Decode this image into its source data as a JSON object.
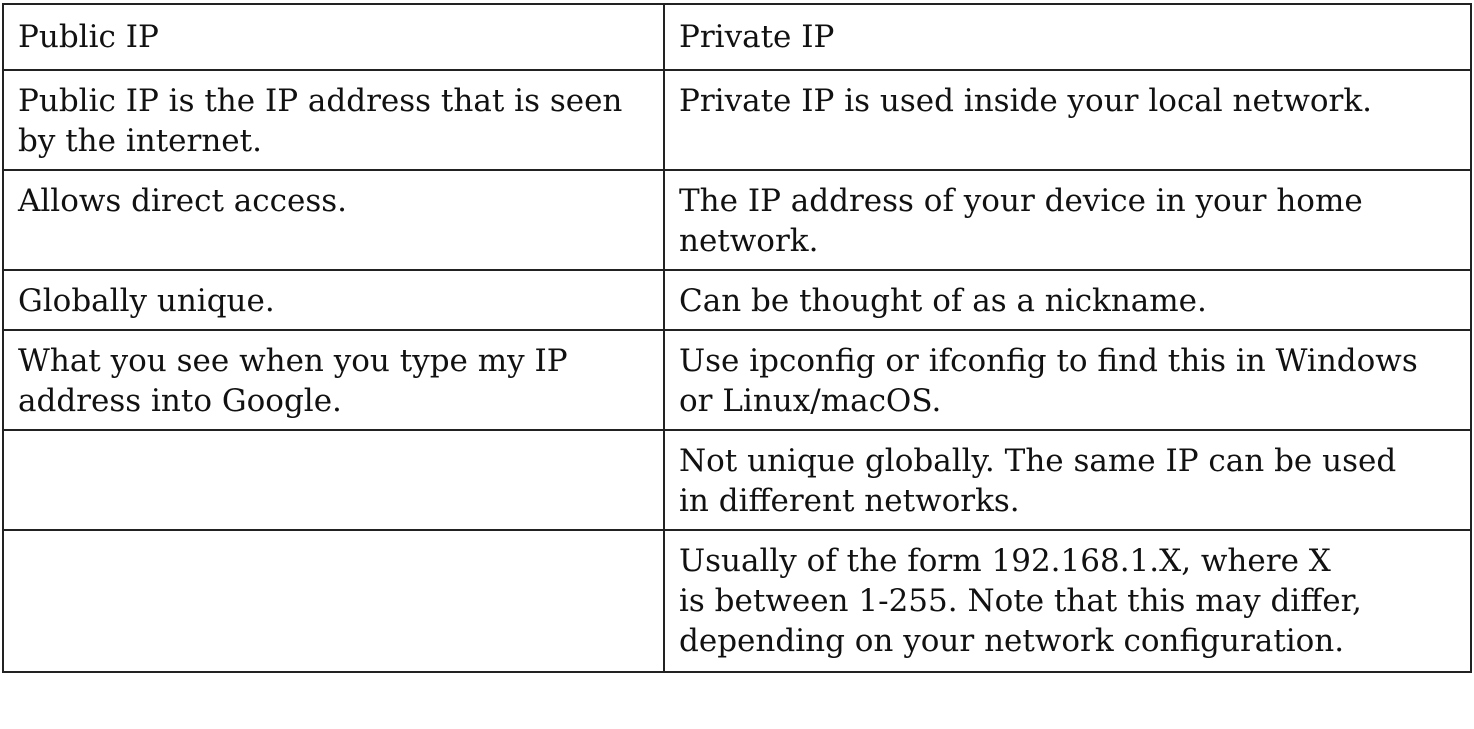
{
  "table": {
    "headers": [
      "Public IP",
      "Private IP"
    ],
    "rows": [
      [
        "Public IP is the IP address that is seen\nby the internet.",
        "Private IP is used inside your local network."
      ],
      [
        "Allows direct access.",
        "The IP address of your device in your home\nnetwork."
      ],
      [
        "Globally unique.",
        "Can be thought of as a nickname."
      ],
      [
        "What you see when you type my IP\naddress into Google.",
        "Use ipconfig or ifconfig to find this in Windows\nor Linux/macOS."
      ],
      [
        "",
        "Not unique globally. The same IP can be used\nin different networks."
      ],
      [
        "",
        "Usually of the form 192.168.1.X, where X\nis between 1-255. Note that this may differ,\ndepending on your network configuration."
      ]
    ]
  }
}
